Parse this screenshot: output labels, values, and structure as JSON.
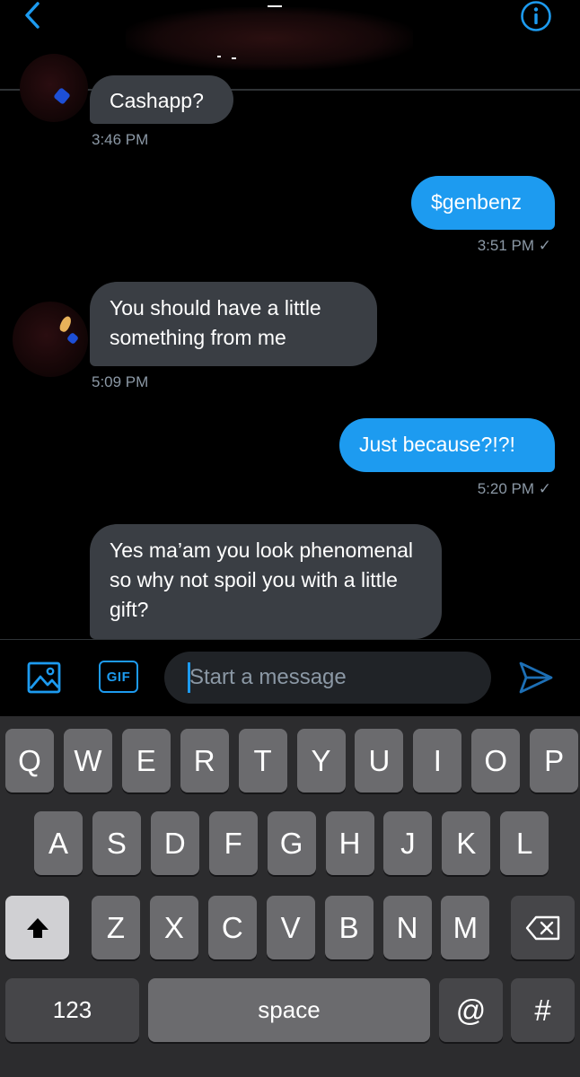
{
  "header": {
    "back_icon": "chevron-left-icon",
    "info_icon": "info-circle-icon",
    "accent": "#1d9bf0"
  },
  "messages": [
    {
      "direction": "in",
      "text": "Cashapp?",
      "time": "3:46 PM"
    },
    {
      "direction": "out",
      "text": "$genbenz",
      "time": "3:51 PM ✓"
    },
    {
      "direction": "in",
      "text": "You should have a little something from me",
      "time": "5:09 PM"
    },
    {
      "direction": "out",
      "text": "Just because?!?!",
      "time": "5:20 PM ✓"
    },
    {
      "direction": "in",
      "text": "Yes ma’am you look phenomenal so why not spoil you with a little gift?",
      "time": ""
    }
  ],
  "composer": {
    "placeholder": "Start a message",
    "gif_label": "GIF",
    "image_icon": "image-icon",
    "send_icon": "send-icon"
  },
  "keyboard": {
    "row1": [
      "Q",
      "W",
      "E",
      "R",
      "T",
      "Y",
      "U",
      "I",
      "O",
      "P"
    ],
    "row2": [
      "A",
      "S",
      "D",
      "F",
      "G",
      "H",
      "J",
      "K",
      "L"
    ],
    "row3": [
      "Z",
      "X",
      "C",
      "V",
      "B",
      "N",
      "M"
    ],
    "shift_icon": "shift-icon",
    "delete_icon": "delete-icon",
    "numbers_label": "123",
    "space_label": "space",
    "at_label": "@",
    "hash_label": "#"
  },
  "colors": {
    "background": "#000000",
    "incoming_bubble": "#3a3e44",
    "outgoing_bubble": "#1d9bf0",
    "timestamp": "#8b98a5",
    "keyboard_bg": "#2c2c2e",
    "key": "#6b6b6e"
  }
}
